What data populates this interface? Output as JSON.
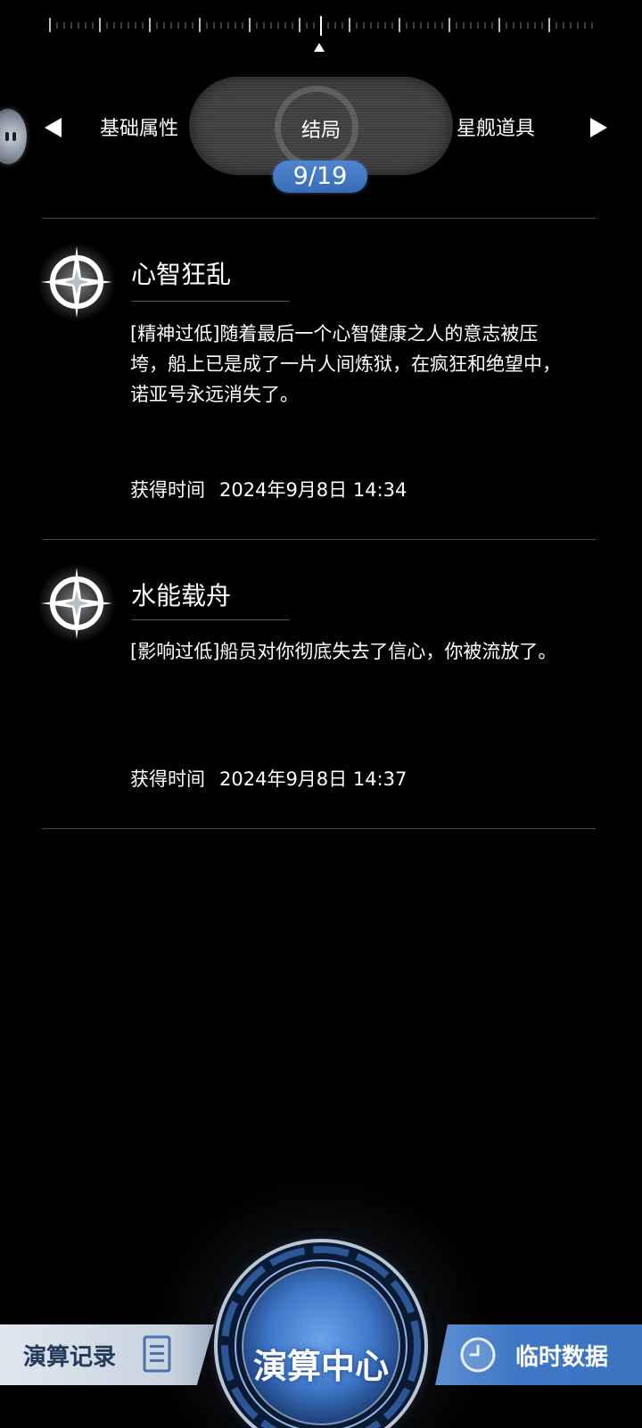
{
  "selector": {
    "left_label": "基础属性",
    "center_label": "结局",
    "right_label": "星舰道具",
    "page_indicator": "9/19"
  },
  "entries": [
    {
      "title": "心智狂乱",
      "description": "[精神过低]随着最后一个心智健康之人的意志被压垮，船上已是成了一片人间炼狱，在疯狂和绝望中，诺亚号永远消失了。",
      "time_label": "获得时间",
      "time_value": "2024年9月8日 14:34"
    },
    {
      "title": "水能载舟",
      "description": "[影响过低]船员对你彻底失去了信心，你被流放了。",
      "time_label": "获得时间",
      "time_value": "2024年9月8日 14:37"
    }
  ],
  "bottom_nav": {
    "left_label": "演算记录",
    "center_label": "演算中心",
    "right_label": "临时数据"
  },
  "colors": {
    "page_badge": "#3f74c2",
    "right_tab": "#3f77c6",
    "left_tab": "#dfe6ee",
    "left_tab_text": "#233a5a"
  }
}
